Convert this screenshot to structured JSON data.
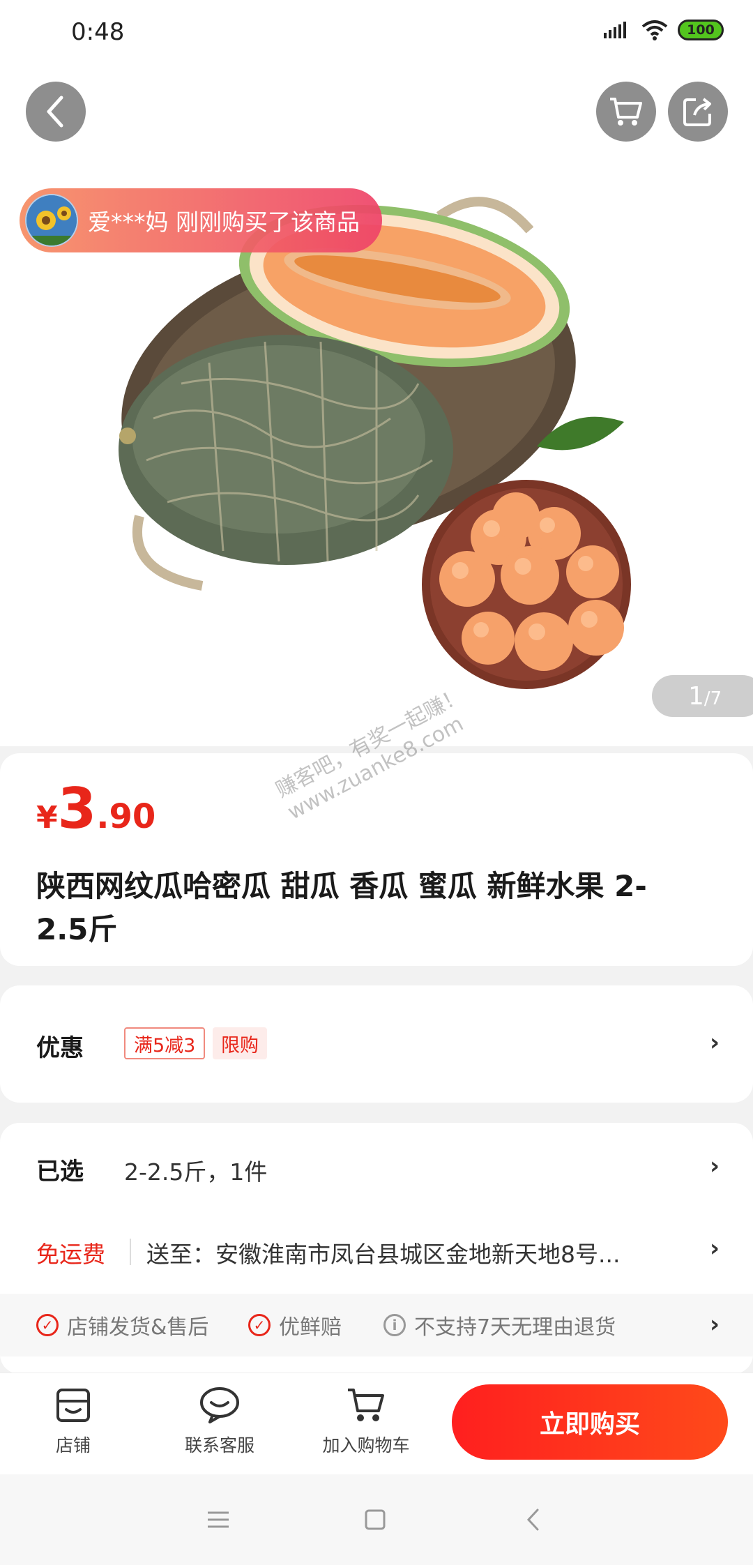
{
  "status_bar": {
    "time": "0:48",
    "battery": "100"
  },
  "hero": {
    "purchase_toast": "爱***妈 刚刚购买了该商品",
    "page_current": "1",
    "page_total": "/7"
  },
  "watermark": {
    "line1": "赚客吧，有奖一起赚！",
    "line2": "www.zuanke8.com"
  },
  "price": {
    "currency": "¥",
    "integer": "3",
    "decimal": ".90"
  },
  "product": {
    "title": "陕西网纹瓜哈密瓜 甜瓜 香瓜 蜜瓜 新鲜水果 2-2.5斤"
  },
  "promo": {
    "label": "优惠",
    "tag_discount": "满5减3",
    "tag_limit": "限购",
    "chevron": "›"
  },
  "selection": {
    "label": "已选",
    "value": "2-2.5斤，1件",
    "free_shipping": "免运费",
    "address": "送至：安徽淮南市凤台县城区金地新天地8号...",
    "chevron": "›"
  },
  "services": [
    {
      "text": "店铺发货&售后",
      "icon": "check-circle-icon"
    },
    {
      "text": "优鲜赔",
      "icon": "check-circle-icon"
    },
    {
      "text": "不支持7天无理由退货",
      "icon": "info-icon"
    }
  ],
  "bottom_bar": {
    "store": "店铺",
    "service": "联系客服",
    "add_cart": "加入购物车",
    "buy_now": "立即购买"
  },
  "colors": {
    "accent": "#e8261a",
    "toast_start": "#f68c62",
    "toast_end": "#ee4368"
  }
}
